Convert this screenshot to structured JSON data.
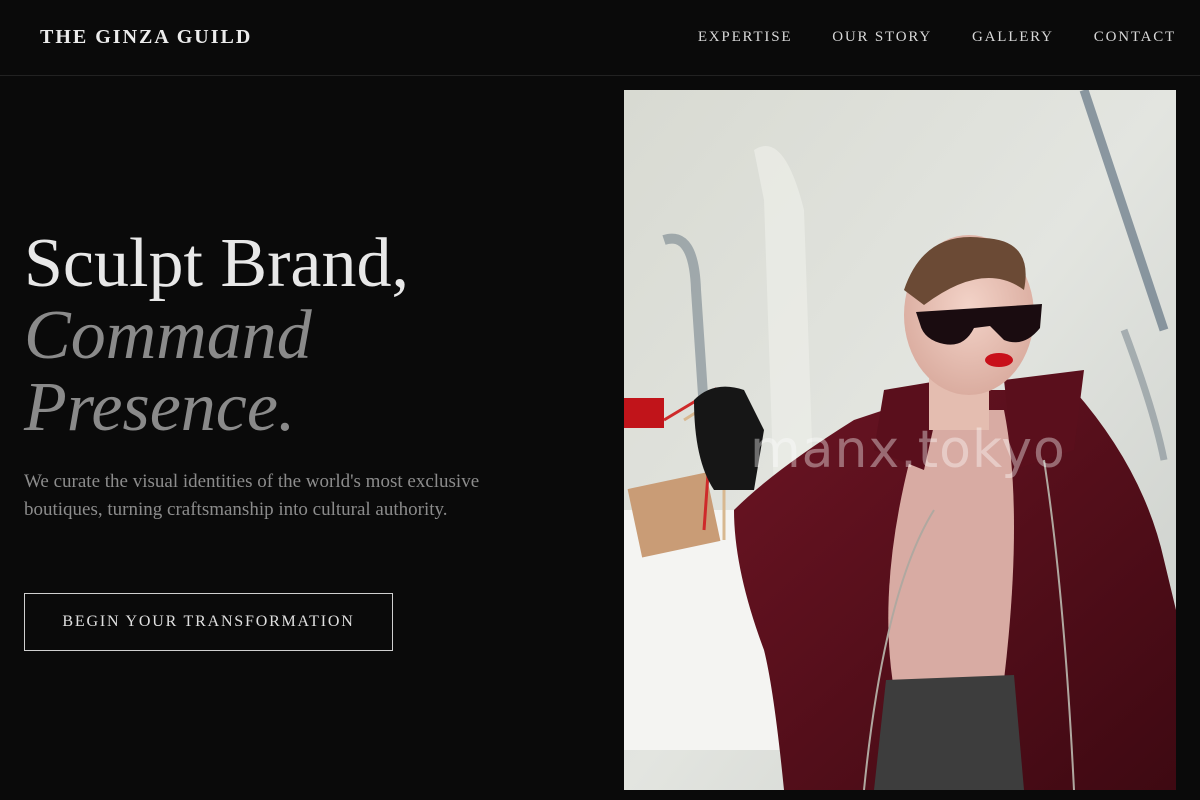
{
  "nav": {
    "brand": "THE GINZA GUILD",
    "items": [
      {
        "label": "EXPERTISE"
      },
      {
        "label": "OUR STORY"
      },
      {
        "label": "GALLERY"
      },
      {
        "label": "CONTACT"
      }
    ]
  },
  "hero": {
    "line1": "Sculpt Brand,",
    "line2": "Command",
    "line3": "Presence.",
    "description": "We curate the visual identities of the world's most exclusive boutiques, turning craftsmanship into cultural authority.",
    "cta_label": "BEGIN YOUR TRANSFORMATION"
  },
  "photo": {
    "watermark": "manx.tokyo",
    "subject": "woman in burgundy coat with sunglasses holding shopping bags"
  },
  "colors": {
    "background": "#0a0a0a",
    "text_primary": "#e8e8e8",
    "text_muted": "#8a8a8a",
    "coat": "#5a0f1c"
  }
}
